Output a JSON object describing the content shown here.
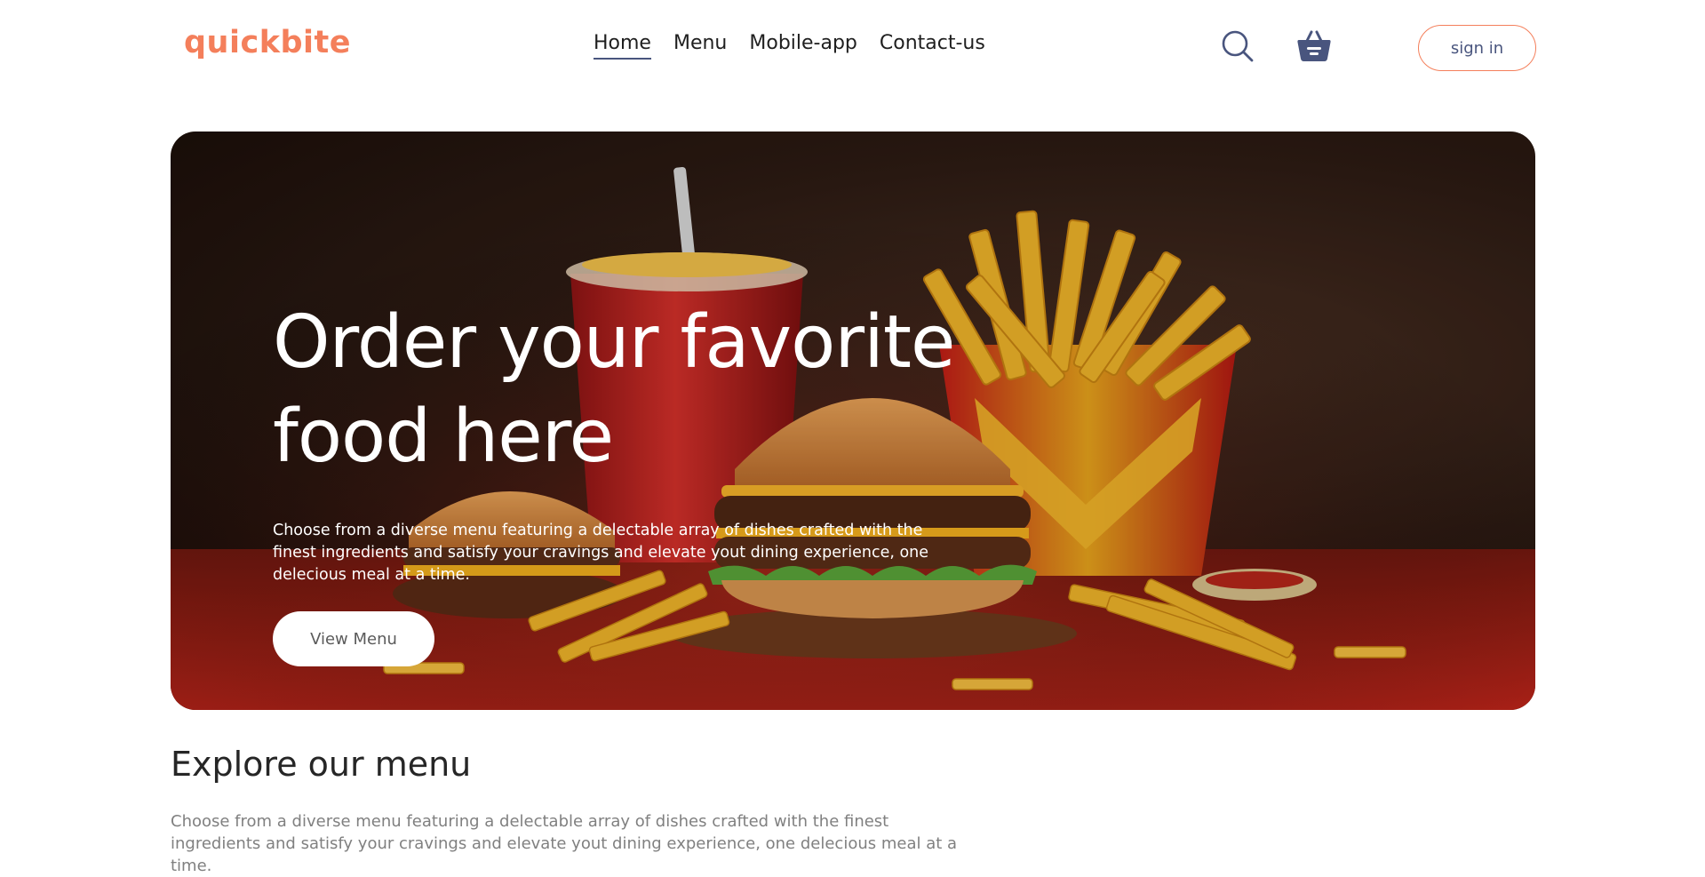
{
  "navbar": {
    "logo": "quickbite",
    "menu": [
      {
        "label": "Home",
        "active": true
      },
      {
        "label": "Menu",
        "active": false
      },
      {
        "label": "Mobile-app",
        "active": false
      },
      {
        "label": "Contact-us",
        "active": false
      }
    ],
    "icons": [
      "search-icon",
      "basket-icon"
    ],
    "signin_label": "sign in"
  },
  "hero": {
    "title_line1": "Order your favorite",
    "title_line2": "food here",
    "description": "Choose from a diverse menu featuring a delectable array of dishes crafted with the finest ingredients and satisfy your cravings and elevate yout dining experience, one delecious meal at a time.",
    "button_label": "View Menu"
  },
  "explore": {
    "title": "Explore our menu",
    "description": "Choose from a diverse menu featuring a delectable array of dishes crafted with the finest ingredients and satisfy your cravings and elevate yout dining experience, one delecious meal at a time."
  },
  "colors": {
    "accent": "#f47f5b",
    "nav_text": "#49557e",
    "heading": "#262626",
    "muted": "#808080"
  }
}
